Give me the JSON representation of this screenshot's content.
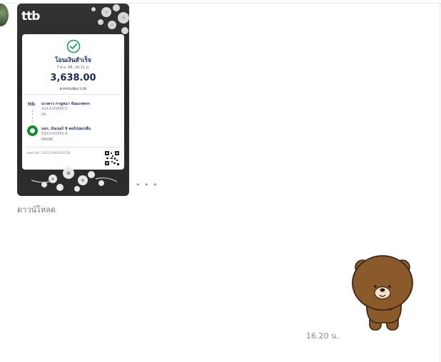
{
  "conversation": {
    "download_label": "ดาวน์โหลด",
    "more_label": "• • •",
    "sent_time": "16.20 น."
  },
  "slip": {
    "bank_logo": "ttb",
    "status": "โอนเงินสำเร็จ",
    "date": "7 พ.ย. 68, 16:11 น.",
    "amount": "3,638.00",
    "fee": "ค่าธรรมเนียม 0.00",
    "from": {
      "name": "นางสาว กาญจนา จัณมะหหรร",
      "account": "XXX-X-XX695-5",
      "bank": "ttb"
    },
    "to": {
      "name": "บจก. มันเบอร์ 9 คอร์ปปอเรชั่น",
      "account": "XXX-X-XX595-9",
      "bank": "KBANK"
    },
    "reference": "รหัสอ้างอิง: 2025110916335736"
  },
  "icons": {
    "success": "check-circle-icon",
    "sticker": "brown-bear-sticker"
  },
  "colors": {
    "slip_navy": "#1a2a5a",
    "success_green": "#1e9e5a",
    "kbank_green": "#138a2f",
    "bear_brown": "#8b5a2b"
  }
}
